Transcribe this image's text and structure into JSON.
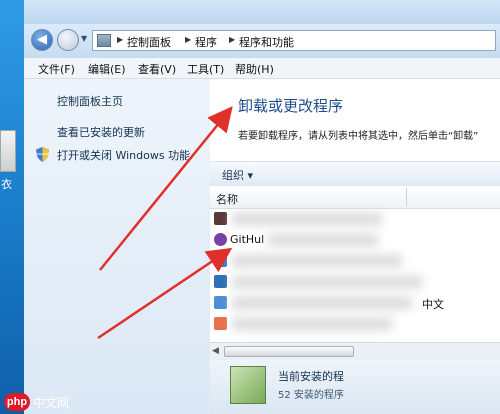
{
  "desktop": {
    "icon_label": "衣"
  },
  "address": {
    "crumbs": [
      "控制面板",
      "程序",
      "程序和功能"
    ]
  },
  "menu": [
    "文件(F)",
    "编辑(E)",
    "查看(V)",
    "工具(T)",
    "帮助(H)"
  ],
  "sidebar": {
    "home": "控制面板主页",
    "updates": "查看已安装的更新",
    "windows_features": "打开或关闭 Windows 功能"
  },
  "main": {
    "title": "卸载或更改程序",
    "description": "若要卸载程序，请从列表中将其选中，然后单击“卸载”"
  },
  "toolbar": {
    "organize": "组织 ▾"
  },
  "list": {
    "column_name": "名称",
    "rows": [
      {
        "label": "",
        "icon_color": "#5a3a3a"
      },
      {
        "label": "GitHul",
        "icon_color": "#7b3fa8"
      },
      {
        "label": "",
        "icon_color": "#3a78c8"
      },
      {
        "label": "",
        "icon_color": "#2f6fb5"
      },
      {
        "label": "中文",
        "icon_color": "#4d8fd6"
      },
      {
        "label": "",
        "icon_color": "#e8704a"
      }
    ]
  },
  "details": {
    "title": "当前安装的程",
    "count": "52 安装的程序"
  },
  "watermark": {
    "badge": "php",
    "text": "中文网"
  },
  "colors": {
    "accent": "#1e4e8c",
    "arrow": "#e0302a"
  }
}
